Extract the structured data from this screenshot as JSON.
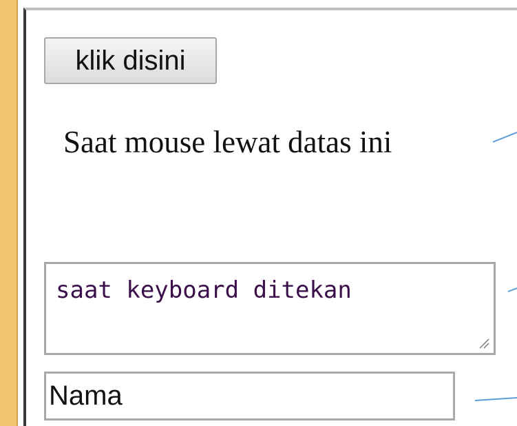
{
  "button": {
    "label": "klik disini"
  },
  "hover_text": "Saat mouse lewat datas ini",
  "textarea": {
    "value": "saat keyboard ditekan"
  },
  "input": {
    "value": "Nama"
  },
  "colors": {
    "accent": "#f3c46e",
    "callout_line": "#5b9bd5",
    "textarea_text": "#3b0f4a"
  }
}
